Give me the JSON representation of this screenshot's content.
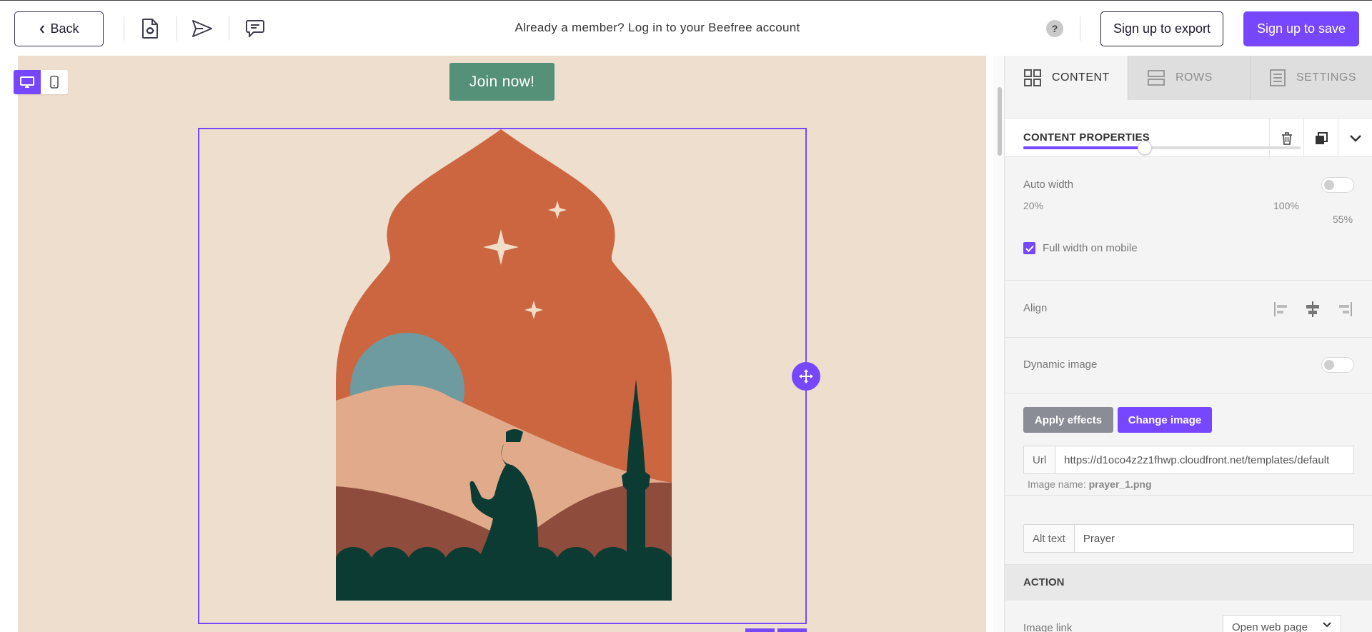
{
  "topbar": {
    "back_label": "Back",
    "member_prompt": "Already a member? Log in to your Beefree account",
    "help_label": "?",
    "export_label": "Sign up to export",
    "save_label": "Sign up to save",
    "icons": [
      "document-preview-icon",
      "send-icon",
      "comment-icon"
    ]
  },
  "canvas": {
    "join_button_label": "Join now!",
    "view_modes": [
      "desktop-icon",
      "mobile-icon"
    ],
    "active_view": "desktop",
    "colors": {
      "background": "#eedecd",
      "join_button": "#559079",
      "selection": "#7747ff",
      "arch": "#cc6640",
      "moon": "#6d9b9f",
      "dune_light": "#e0aa8b",
      "dune_dark": "#8e4c3d",
      "silhouette": "#0c3b34"
    }
  },
  "panel": {
    "tabs": [
      {
        "label": "CONTENT",
        "icon": "grid-icon",
        "active": true
      },
      {
        "label": "ROWS",
        "icon": "rows-icon",
        "active": false
      },
      {
        "label": "SETTINGS",
        "icon": "settings-list-icon",
        "active": false
      }
    ],
    "content_properties": {
      "title": "CONTENT PROPERTIES",
      "actions": [
        "trash-icon",
        "duplicate-icon",
        "chevron-down-icon"
      ]
    },
    "auto_width": {
      "label": "Auto width",
      "enabled": false,
      "min_label": "20%",
      "max_label": "100%",
      "value_label": "55%",
      "value_fraction": 0.4375
    },
    "full_width_mobile": {
      "label": "Full width on mobile",
      "checked": true
    },
    "align": {
      "label": "Align",
      "options": [
        "align-left-icon",
        "align-center-icon",
        "align-right-icon"
      ],
      "selected": "center"
    },
    "dynamic_image": {
      "label": "Dynamic image",
      "enabled": false
    },
    "apply_effects_label": "Apply effects",
    "change_image_label": "Change image",
    "url": {
      "prefix": "Url",
      "value": "https://d1oco4z2z1fhwp.cloudfront.net/templates/default"
    },
    "image_name": {
      "label": "Image name:",
      "value": "prayer_1.png"
    },
    "alt_text": {
      "prefix": "Alt text",
      "value": "Prayer"
    },
    "action": {
      "header": "ACTION",
      "image_link_label": "Image link",
      "link_type": "Open web page"
    },
    "accent_color": "#7747ff"
  }
}
